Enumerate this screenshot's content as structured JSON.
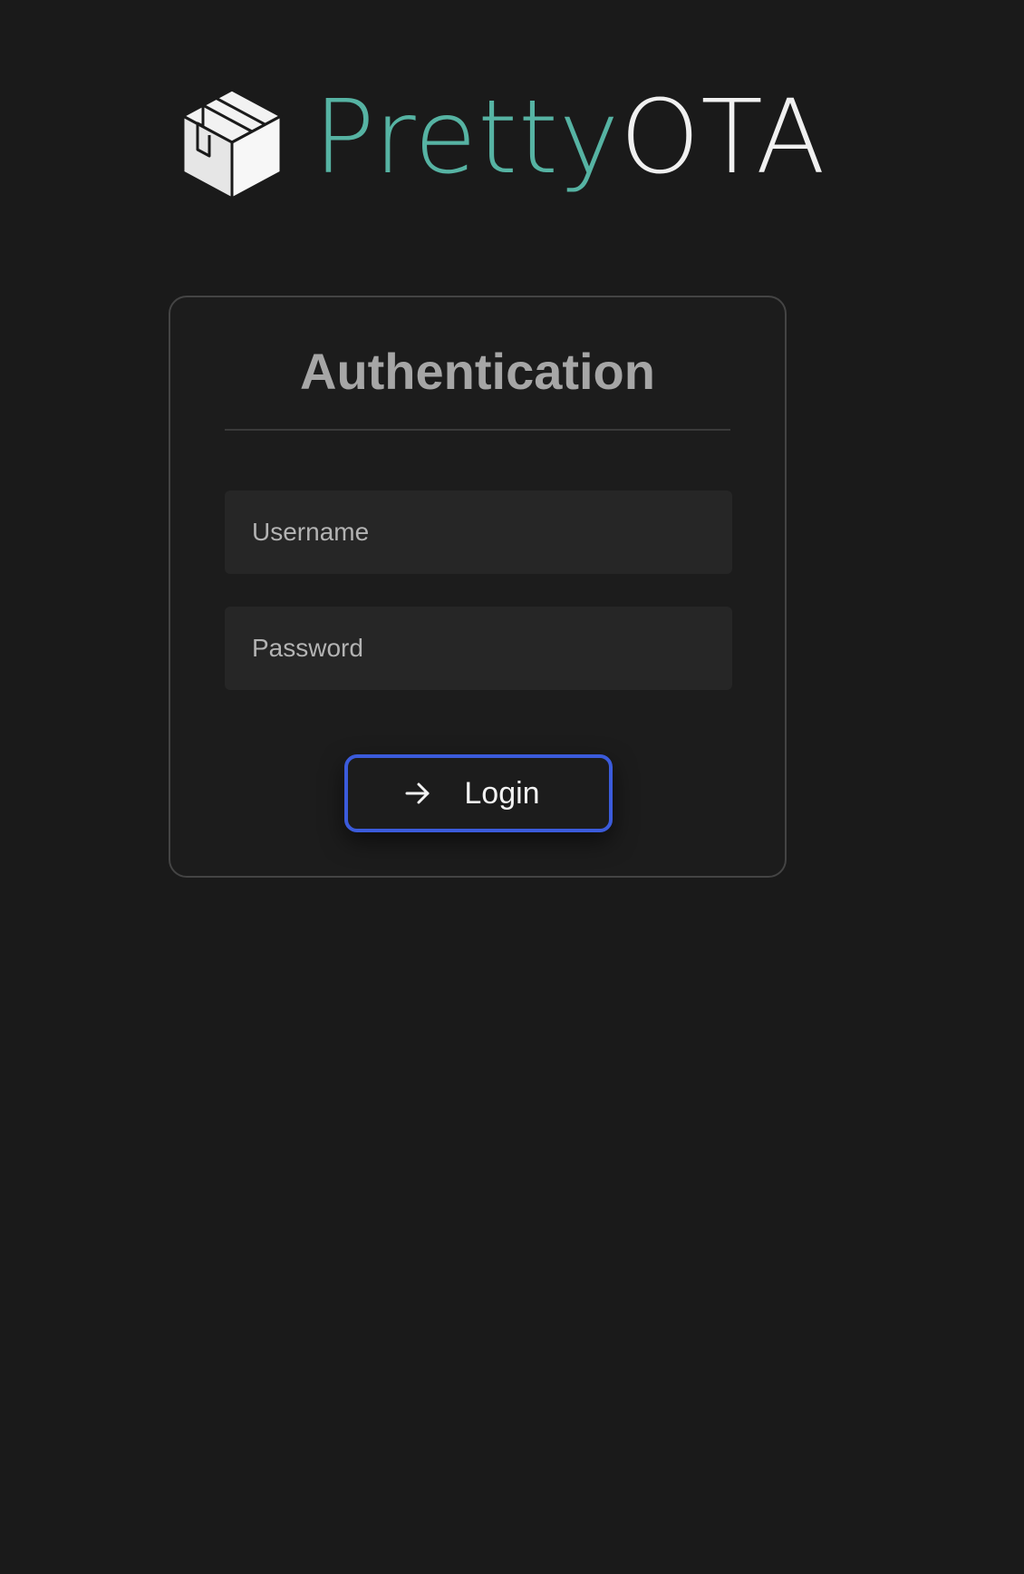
{
  "brand": {
    "logo_icon": "package-box-icon",
    "name_part_1": "Pretty",
    "name_part_2": "OTA",
    "accent_color": "#56b3a3"
  },
  "auth": {
    "title": "Authentication",
    "username": {
      "placeholder": "Username",
      "value": ""
    },
    "password": {
      "placeholder": "Password",
      "value": ""
    },
    "login_button": {
      "label": "Login",
      "icon": "arrow-right-icon",
      "border_color": "#3b5bdb"
    }
  }
}
